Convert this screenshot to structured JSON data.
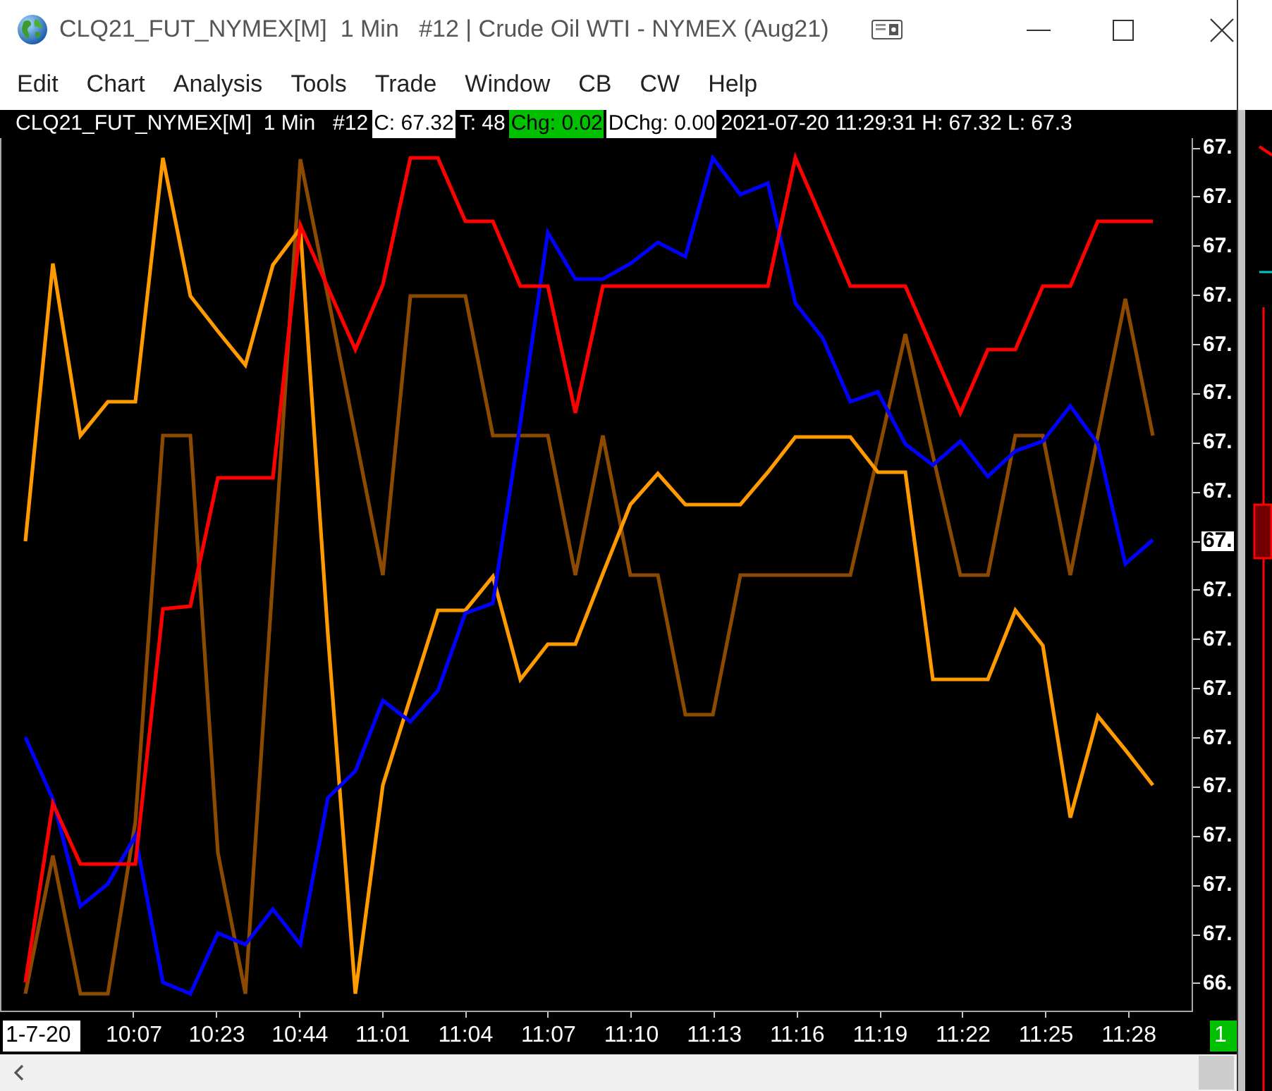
{
  "window": {
    "title": "CLQ21_FUT_NYMEX[M]  1 Min   #12 | Crude Oil WTI - NYMEX (Aug21)"
  },
  "menu": [
    {
      "label": "Edit"
    },
    {
      "label": "Chart"
    },
    {
      "label": "Analysis"
    },
    {
      "label": "Tools"
    },
    {
      "label": "Trade"
    },
    {
      "label": "Window"
    },
    {
      "label": "CB"
    },
    {
      "label": "CW"
    },
    {
      "label": "Help"
    }
  ],
  "info_bar": [
    {
      "text": "CLQ21_FUT_NYMEX[M]  1 Min   #12",
      "kind": "plain"
    },
    {
      "text": "C: 67.32",
      "kind": "light"
    },
    {
      "text": "T: 48",
      "kind": "plain"
    },
    {
      "text": "Chg: 0.02",
      "kind": "up"
    },
    {
      "text": "DChg: 0.00",
      "kind": "light"
    },
    {
      "text": "2021-07-20 11:29:31 H: 67.32 L: 67.3",
      "kind": "plain"
    }
  ],
  "chart": {
    "price_labels": [
      {
        "text": "67.",
        "kind": "tick"
      },
      {
        "text": "67.",
        "kind": "tick"
      },
      {
        "text": "67.",
        "kind": "tick"
      },
      {
        "text": "67.",
        "kind": "tick"
      },
      {
        "text": "67.",
        "kind": "tick"
      },
      {
        "text": "67.",
        "kind": "tick"
      },
      {
        "text": "67.",
        "kind": "tick"
      },
      {
        "text": "67.",
        "kind": "tick"
      },
      {
        "text": "67.",
        "kind": "current"
      },
      {
        "text": "67.",
        "kind": "tick"
      },
      {
        "text": "67.",
        "kind": "tick"
      },
      {
        "text": "67.",
        "kind": "tick"
      },
      {
        "text": "67.",
        "kind": "tick"
      },
      {
        "text": "67.",
        "kind": "tick"
      },
      {
        "text": "67.",
        "kind": "tick"
      },
      {
        "text": "67.",
        "kind": "tick"
      },
      {
        "text": "67.",
        "kind": "tick"
      },
      {
        "text": "66.",
        "kind": "tick"
      }
    ],
    "date_label": "1-7-20",
    "time_labels": [
      "10:07",
      "10:23",
      "10:44",
      "11:01",
      "11:04",
      "11:07",
      "11:10",
      "11:13",
      "11:16",
      "11:19",
      "11:22",
      "11:25",
      "11:28"
    ],
    "bar_counter": "1"
  }
}
